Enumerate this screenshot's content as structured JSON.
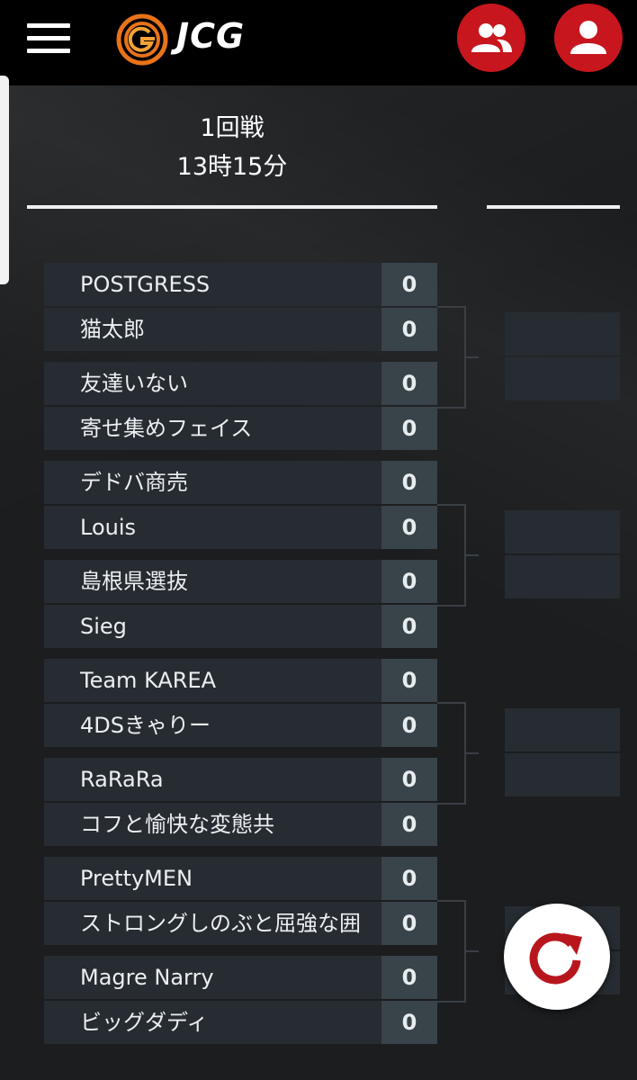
{
  "header": {
    "brand": "JCG",
    "menu_icon": "hamburger-menu-icon",
    "teams_icon": "group-icon",
    "account_icon": "person-icon",
    "accent_color": "#c8161e"
  },
  "round": {
    "title": "1回戦",
    "time": "13時15分"
  },
  "teams": [
    {
      "name": "POSTGRESS",
      "score": "0"
    },
    {
      "name": "猫太郎",
      "score": "0"
    },
    {
      "name": "友達いない",
      "score": "0"
    },
    {
      "name": "寄せ集めフェイス",
      "score": "0"
    },
    {
      "name": "デドバ商売",
      "score": "0"
    },
    {
      "name": "Louis",
      "score": "0"
    },
    {
      "name": "島根県選抜",
      "score": "0"
    },
    {
      "name": "Sieg",
      "score": "0"
    },
    {
      "name": "Team KAREA",
      "score": "0"
    },
    {
      "name": "4DSきゃりー",
      "score": "0"
    },
    {
      "name": "RaRaRa",
      "score": "0"
    },
    {
      "name": "コフと愉快な変態共",
      "score": "0"
    },
    {
      "name": "PrettyMEN",
      "score": "0"
    },
    {
      "name": "ストロングしのぶと屈強な囲",
      "score": "0"
    },
    {
      "name": "Magre Narry",
      "score": "0"
    },
    {
      "name": "ビッグダディ",
      "score": "0"
    }
  ],
  "refresh_icon": "refresh-icon"
}
